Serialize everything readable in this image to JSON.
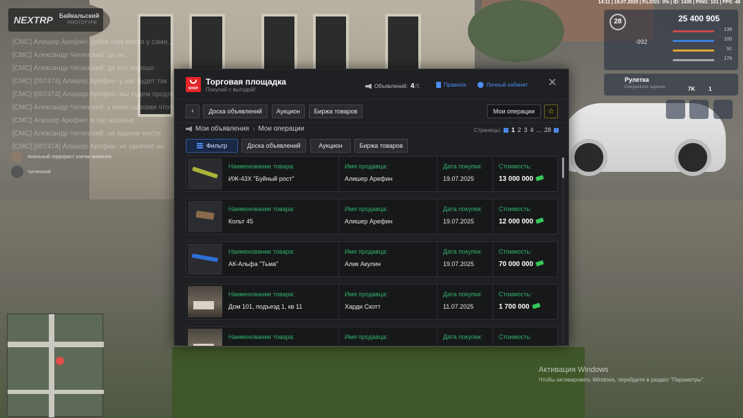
{
  "hud": {
    "topbar": "14:11 | 19.07.2025 | P.LOSS: 0% | ID: 1435 | PING: 101 | FPS: 48",
    "money": "25 400 905",
    "level": "28",
    "negative": "-992",
    "stats": [
      {
        "value": "139",
        "color": "#c94a4a"
      },
      {
        "value": "100",
        "color": "#3c7fd8"
      },
      {
        "value": "91",
        "color": "#e0a632"
      },
      {
        "value": "178",
        "color": "#aaaaaa"
      }
    ],
    "roulette_title": "Рулетка",
    "roulette_sub": "Ежедневное задание",
    "coins_1": "7K",
    "coins_2": "1"
  },
  "server": {
    "brand": "NEXTRP",
    "name": "Байкальский",
    "sub": "PROTOTYPE"
  },
  "chat": {
    "lines": [
      "[СМС] Алишер Арефин: дайте нам место у сами...",
      "[СМС] Александр Читинский: да не...",
      "[СМС] Александр Читинский: да все хорошо",
      "[СМС] [007474] Алишер Арефин: у вас будет так",
      "[СМС] [007474] Алишер Арефин: мы будем продавать",
      "[СМС] Александр Читинский: у меня засками чтоли",
      "[СМС] Алишер Арефин: а где машина",
      "[СМС] Александр Читинский: на заднем месте",
      "[СМС] [007474] Алишер Арефин: не занятие на"
    ],
    "player1": "Анальный террорист клички мамочка",
    "player2": "Читинский"
  },
  "windows": {
    "title": "Активация Windows",
    "sub": "Чтобы активировать Windows, перейдите в раздел \"Параметры\"."
  },
  "panel": {
    "logo_text": "SHOP",
    "title": "Торговая площадка",
    "subtitle": "Покупай с выгодой!",
    "ads_label": "Объявлений:",
    "ads_count": "4",
    "ads_max": "/5",
    "rules": "Правила",
    "cabinet": "Личный кабинет",
    "close": "✕",
    "nav": {
      "back": "‹",
      "board": "Доска объявлений",
      "auction": "Аукцион",
      "exchange": "Биржа товаров",
      "my_ops": "Мои операции",
      "star": "☆"
    },
    "breadcrumb": {
      "my_ads": "Мои объявления",
      "sep": "›",
      "current": "Мои операции"
    },
    "pages": {
      "label": "Страницы:",
      "prev": "‹",
      "items": [
        "1",
        "2",
        "3",
        "4",
        "...",
        "28"
      ],
      "next": "›"
    },
    "filters": {
      "filter": "Фильтр",
      "board": "Доска объявлений",
      "auction": "Аукцион",
      "exchange": "Биржа товаров"
    },
    "columns": {
      "item": "Наименование товара:",
      "seller": "Имя продавца:",
      "date": "Дата покупки:",
      "price": "Стоимость:"
    },
    "rows": [
      {
        "item": "ИЖ-43Х \"Буйный рост\"",
        "seller": "Алишер Арефин",
        "date": "19.07.2025",
        "price": "13 000 000",
        "thumb_color": "#a9b43a"
      },
      {
        "item": "Кольт 45",
        "seller": "Алишер Арефин",
        "date": "19.07.2025",
        "price": "12 000 000",
        "thumb_color": "#8a6a4a"
      },
      {
        "item": "АК-Альфа \"Тьма\"",
        "seller": "Алик Акулин",
        "date": "19.07.2025",
        "price": "70 000 000",
        "thumb_color": "#2f6fd8"
      },
      {
        "item": "Дом 101, подъезд 1, кв 11",
        "seller": "Харди Скотт",
        "date": "11.07.2025",
        "price": "1 700 000",
        "thumb_color": "room"
      },
      {
        "item": "",
        "seller": "",
        "date": "",
        "price": "",
        "thumb_color": "room"
      }
    ]
  }
}
